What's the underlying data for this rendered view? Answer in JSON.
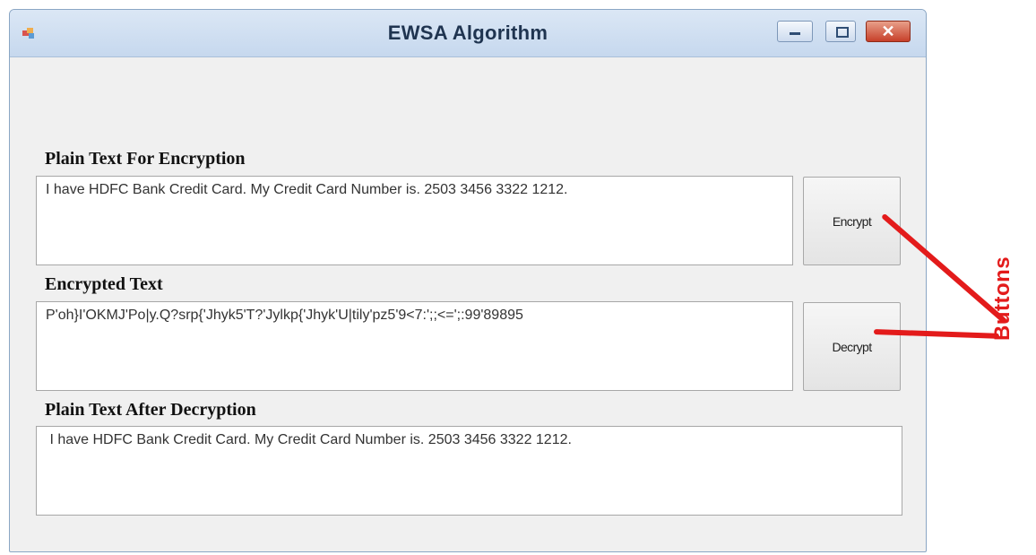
{
  "window": {
    "title": "EWSA Algorithm"
  },
  "form": {
    "plain_label": "Plain Text For Encryption",
    "plain_value": "I have HDFC Bank Credit Card. My Credit Card Number is. 2503 3456 3322 1212.",
    "encrypted_label": "Encrypted Text",
    "encrypted_value": "P'oh}I'OKMJ'Po|y.Q?srp{'Jhyk5'T?'Jylkp{'Jhyk'U|tily'pz5'9<7:';;<=';:99'89895",
    "decrypted_label": "Plain Text After Decryption",
    "decrypted_value": " I have HDFC Bank Credit Card. My Credit Card Number is. 2503 3456 3322 1212.",
    "encrypt_button": "Encrypt",
    "decrypt_button": "Decrypt"
  },
  "annotation": {
    "label": "Buttons",
    "color": "#e31b1b"
  },
  "icons": {
    "app": "app-icon",
    "minimize": "minimize-icon",
    "maximize": "maximize-icon",
    "close": "close-icon"
  }
}
